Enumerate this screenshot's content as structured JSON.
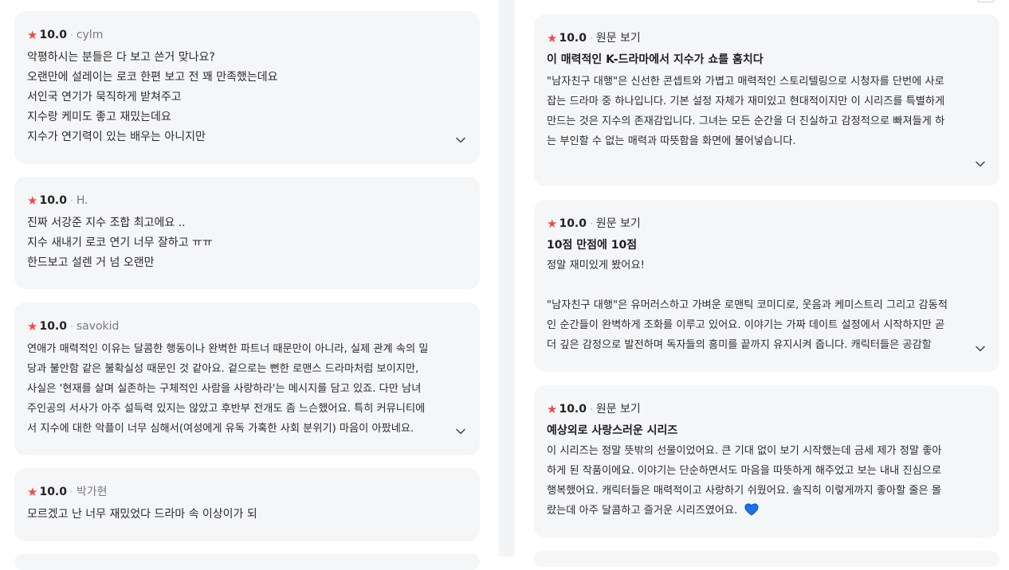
{
  "left_reviews": [
    {
      "rating": "10.0",
      "author": "cylm",
      "lines": [
        "악평하시는 분들은 다 보고 쓴거 맞나요?",
        "오랜만에 설레이는 로코 한편 보고 전 꽤 만족했는데요",
        "서인국 연기가 묵직하게 받쳐주고",
        "지수랑 케미도 좋고 재밌는데요",
        "지수가 연기력이 있는 배우는 아니지만"
      ]
    },
    {
      "rating": "10.0",
      "author": "H.",
      "lines": [
        "진짜 서강준 지수 조합 최고에요 ..",
        "지수 새내기 로코 연기 너무 잘하고 ㅠㅠ",
        "한드보고 설렌 거 넘 오랜만"
      ]
    },
    {
      "rating": "10.0",
      "author": "savokid",
      "lines": [
        "연애가 매력적인 이유는 달콤한 행동이나 완벽한 파트너 때문만이 아니라, 실제 관계 속의 밀",
        "당과 불안함 같은 불확실성 때문인 것 같아요. 겉으로는 뻔한 로맨스 드라마처럼 보이지만,",
        "사실은 '현재를 살며 실존하는 구체적인 사람을 사랑하라'는 메시지를 담고 있죠. 다만 남녀",
        "주인공의 서사가 아주 설득력 있지는 않았고 후반부 전개도 좀 느슨했어요. 특히 커뮤니티에",
        "서 지수에 대한 악플이 너무 심해서(여성에게 유독 가혹한 사회 분위기) 마음이 아팠네요."
      ]
    },
    {
      "rating": "10.0",
      "author": "박가현",
      "lines": [
        "모르겠고 난 너무 재밌었다 드라마 속 이상이가 되"
      ]
    }
  ],
  "right_reviews": [
    {
      "rating": "10.0",
      "link": "원문 보기",
      "title": "이 매력적인 K-드라마에서 지수가 쇼를 훔치다",
      "lines": [
        "\"남자친구 대행\"은 신선한 콘셉트와 가볍고 매력적인 스토리텔링으로 시청자를 단번에 사로",
        "잡는 드라마 중 하나입니다. 기본 설정 자체가 재미있고 현대적이지만 이 시리즈를 특별하게",
        "만드는 것은 지수의 존재감입니다. 그녀는 모든 순간을 더 진실하고 감정적으로 빠져들게 하",
        "는 부인할 수 없는 매력과 따뜻함을 화면에 불어넣습니다."
      ]
    },
    {
      "rating": "10.0",
      "link": "원문 보기",
      "title": "10점 만점에 10점",
      "lines": [
        "정말 재미있게 봤어요!",
        "",
        "\"남자친구 대행\"은 유머러스하고 가벼운 로맨틱 코미디로, 웃음과 케미스트리 그리고 감동적",
        "인 순간들이 완벽하게 조화를 이루고 있어요. 이야기는 가짜 데이트 설정에서 시작하지만 곧",
        "더 깊은 감정으로 발전하며 독자들의 흥미를 끝까지 유지시켜 줍니다. 캐릭터들은 공감할"
      ]
    },
    {
      "rating": "10.0",
      "link": "원문 보기",
      "title": "예상외로 사랑스러운 시리즈",
      "lines": [
        "이 시리즈는 정말 뜻밖의 선물이었어요. 큰 기대 없이 보기 시작했는데 금세 제가 정말 좋아",
        "하게 된 작품이에요. 이야기는 단순하면서도 마음을 따뜻하게 해주었고 보는 내내 진심으로",
        "행복했어요. 캐릭터들은 매력적이고 사랑하기 쉬웠어요. 솔직히 이렇게까지 좋아할 줄은 몰",
        "랐는데 아주 달콤하고 즐거운 시리즈였어요."
      ]
    }
  ],
  "colors": {
    "star": "#ee4a4a",
    "card_bg": "#f5f6f8",
    "heart": "#1d73e8"
  },
  "icons": {
    "star": "★",
    "expand": "chevron-down-icon",
    "heart": "blue-heart-icon"
  }
}
